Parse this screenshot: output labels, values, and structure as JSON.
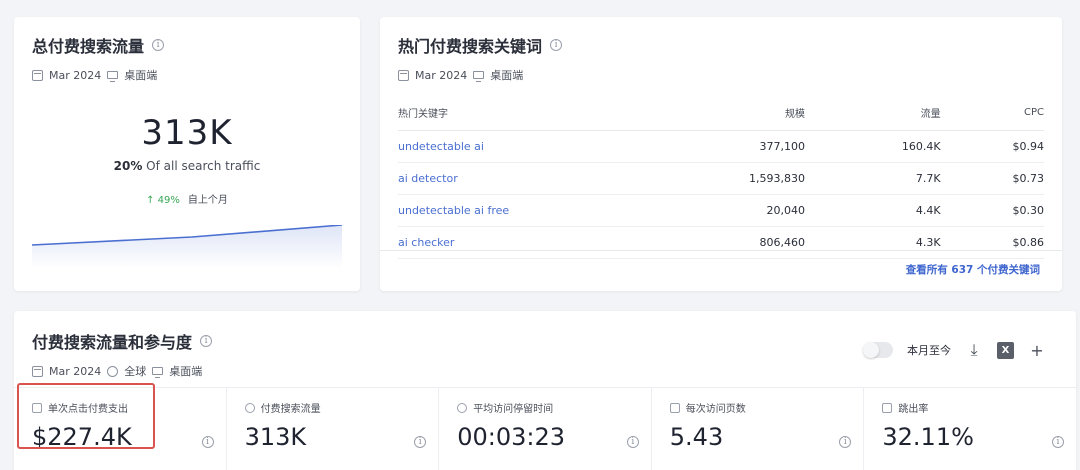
{
  "traffic_card": {
    "title": "总付费搜索流量",
    "date": "Mar 2024",
    "device": "桌面端",
    "value": "313K",
    "share_pct": "20%",
    "share_text": " Of all search traffic",
    "change": "↑ 49%",
    "change_label": "自上个月"
  },
  "keywords_card": {
    "title": "热门付费搜索关键词",
    "date": "Mar 2024",
    "device": "桌面端",
    "columns": [
      "热门关键字",
      "规模",
      "流量",
      "CPC"
    ],
    "rows": [
      [
        "undetectable ai",
        "377,100",
        "160.4K",
        "$0.94"
      ],
      [
        "ai detector",
        "1,593,830",
        "7.7K",
        "$0.73"
      ],
      [
        "undetectable ai free",
        "20,040",
        "4.4K",
        "$0.30"
      ],
      [
        "ai checker",
        "806,460",
        "4.3K",
        "$0.86"
      ]
    ],
    "view_all": "查看所有 637 个付费关键词"
  },
  "engagement_card": {
    "title": "付费搜索流量和参与度",
    "date": "Mar 2024",
    "region": "全球",
    "device": "桌面端",
    "toggle_label": "本月至今",
    "metrics": [
      {
        "label": "单次点击付费支出",
        "value": "$227.4K"
      },
      {
        "label": "付费搜索流量",
        "value": "313K"
      },
      {
        "label": "平均访问停留时间",
        "value": "00:03:23"
      },
      {
        "label": "每次访问页数",
        "value": "5.43"
      },
      {
        "label": "跳出率",
        "value": "32.11%"
      }
    ]
  },
  "colors": {
    "accent": "#3f66cf",
    "highlight": "#d9534f",
    "positive": "#3aa757"
  }
}
